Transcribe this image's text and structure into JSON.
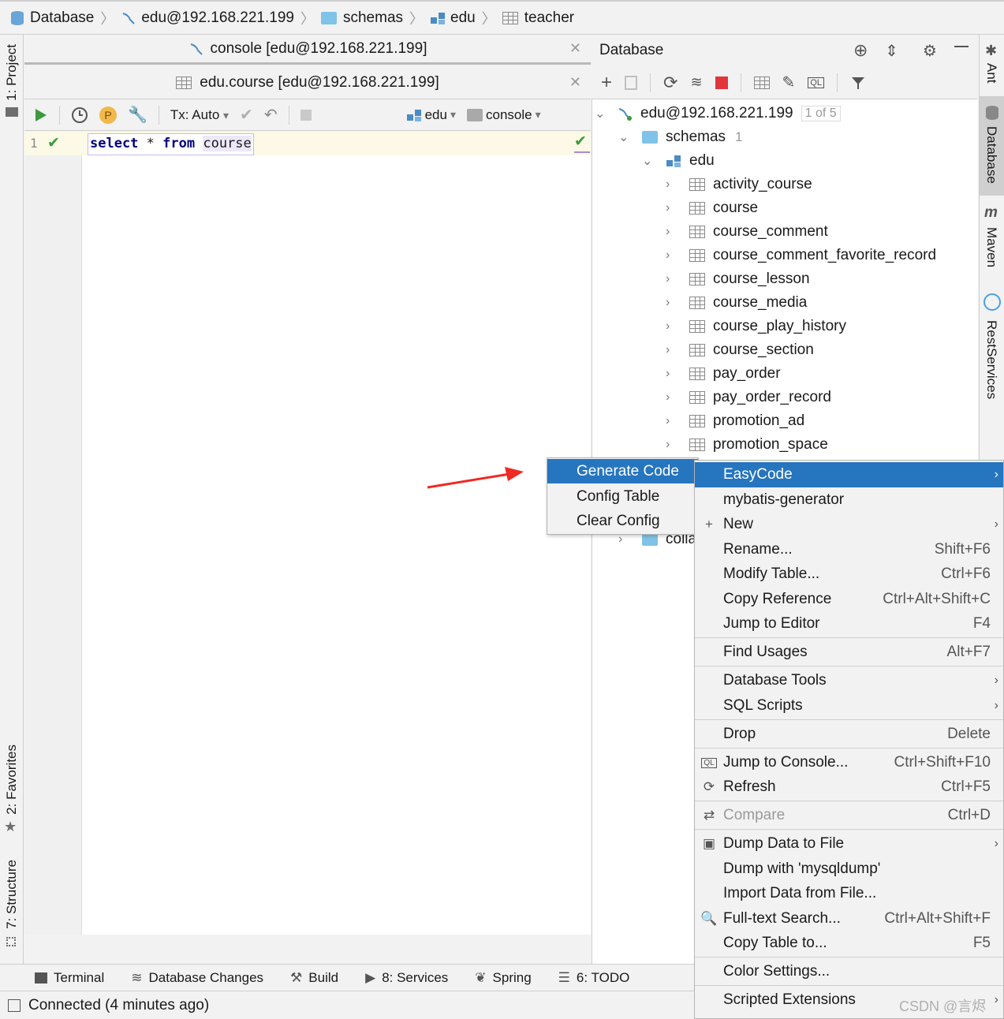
{
  "breadcrumb": [
    "Database",
    "edu@192.168.221.199",
    "schemas",
    "edu",
    "teacher"
  ],
  "left_strip": {
    "project": "1: Project",
    "favorites": "2: Favorites",
    "structure": "7: Structure"
  },
  "right_strip": {
    "ant": "Ant",
    "database": "Database",
    "maven": "Maven",
    "rest": "RestServices"
  },
  "editor": {
    "tab1": "console [edu@192.168.221.199]",
    "tab2": "edu.course [edu@192.168.221.199]",
    "toolbar": {
      "tx": "Tx: Auto",
      "schema": "edu",
      "console": "console",
      "p_badge": "P"
    },
    "line_number": "1",
    "code": {
      "kw1": "select",
      "star": " * ",
      "kw2": "from",
      "table": "course"
    }
  },
  "db_panel": {
    "title": "Database",
    "connection": "edu@192.168.221.199",
    "conn_badge": "1 of 5",
    "schemas": "schemas",
    "schemas_count": "1",
    "schema": "edu",
    "tables": [
      "activity_course",
      "course",
      "course_comment",
      "course_comment_favorite_record",
      "course_lesson",
      "course_media",
      "course_play_history",
      "course_section",
      "pay_order",
      "pay_order_record",
      "promotion_ad",
      "promotion_space"
    ],
    "colla_partial": "colla"
  },
  "submenu": [
    "Generate Code",
    "Config Table",
    "Clear Config"
  ],
  "context_menu": {
    "items": [
      {
        "label": "EasyCode",
        "shortcut": "",
        "arrow": true
      },
      {
        "label": "mybatis-generator",
        "shortcut": ""
      },
      {
        "label": "New",
        "shortcut": "",
        "arrow": true
      },
      {
        "label": "Rename...",
        "shortcut": "Shift+F6"
      },
      {
        "label": "Modify Table...",
        "shortcut": "Ctrl+F6"
      },
      {
        "label": "Copy Reference",
        "shortcut": "Ctrl+Alt+Shift+C"
      },
      {
        "label": "Jump to Editor",
        "shortcut": "F4"
      },
      {
        "label": "Find Usages",
        "shortcut": "Alt+F7"
      },
      {
        "label": "Database Tools",
        "shortcut": "",
        "arrow": true
      },
      {
        "label": "SQL Scripts",
        "shortcut": "",
        "arrow": true
      },
      {
        "label": "Drop",
        "shortcut": "Delete"
      },
      {
        "label": "Jump to Console...",
        "shortcut": "Ctrl+Shift+F10"
      },
      {
        "label": "Refresh",
        "shortcut": "Ctrl+F5"
      },
      {
        "label": "Compare",
        "shortcut": "Ctrl+D"
      },
      {
        "label": "Dump Data to File",
        "shortcut": "",
        "arrow": true
      },
      {
        "label": "Dump with 'mysqldump'",
        "shortcut": ""
      },
      {
        "label": "Import Data from File...",
        "shortcut": ""
      },
      {
        "label": "Full-text Search...",
        "shortcut": "Ctrl+Alt+Shift+F"
      },
      {
        "label": "Copy Table to...",
        "shortcut": "F5"
      },
      {
        "label": "Color Settings...",
        "shortcut": ""
      },
      {
        "label": "Scripted Extensions",
        "shortcut": "",
        "arrow": true
      }
    ]
  },
  "bottom_tools": [
    "Terminal",
    "Database Changes",
    "Build",
    "8: Services",
    "Spring",
    "6: TODO"
  ],
  "status": "Connected (4 minutes ago)",
  "watermark": "CSDN @言烬",
  "colors": {
    "selection": "#2675bf",
    "folder": "#7fc3e8",
    "run_green": "#3c9a3c",
    "stop_red": "#e0353b",
    "arrow_red": "#ee2a24"
  }
}
